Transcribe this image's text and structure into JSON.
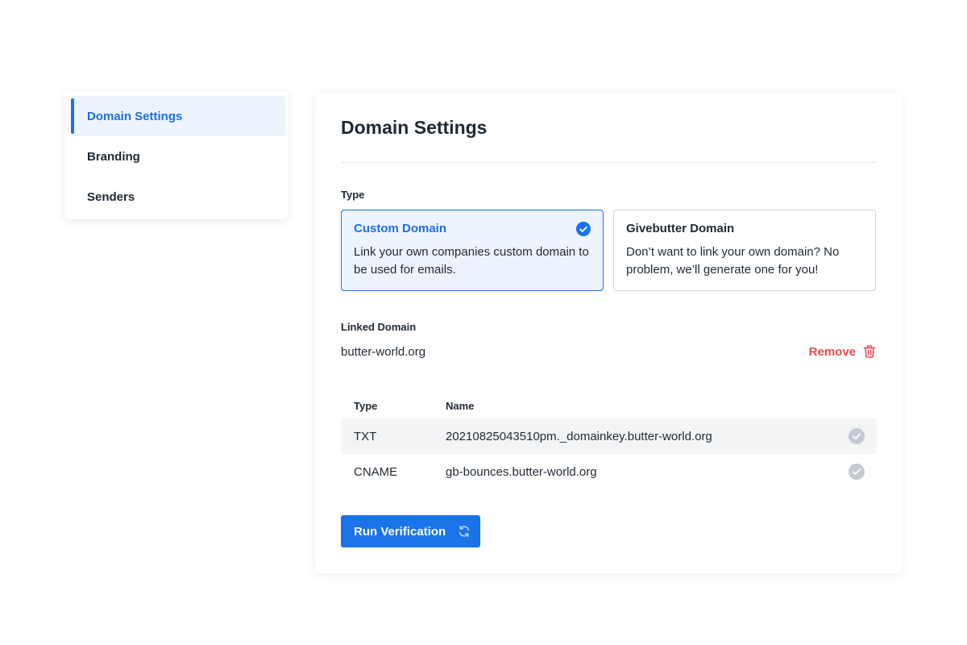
{
  "sidebar": {
    "items": [
      {
        "label": "Domain Settings",
        "active": true
      },
      {
        "label": "Branding",
        "active": false
      },
      {
        "label": "Senders",
        "active": false
      }
    ]
  },
  "main": {
    "title": "Domain Settings",
    "type_label": "Type",
    "options": [
      {
        "title": "Custom Domain",
        "description": "Link your own companies custom domain to be used for emails.",
        "selected": true
      },
      {
        "title": "Givebutter Domain",
        "description": "Don’t want to link your own domain? No problem, we’ll generate one for you!",
        "selected": false
      }
    ],
    "linked_domain_label": "Linked Domain",
    "linked_domain_value": "butter-world.org",
    "remove_label": "Remove",
    "records": {
      "headers": {
        "type": "Type",
        "name": "Name"
      },
      "rows": [
        {
          "type": "TXT",
          "name": "20210825043510pm._domainkey.butter-world.org",
          "status": "check-icon"
        },
        {
          "type": "CNAME",
          "name": "gb-bounces.butter-world.org",
          "status": "check-icon"
        }
      ]
    },
    "run_button_label": "Run Verification"
  },
  "colors": {
    "accent": "#1a73e8",
    "selected_bg": "#ecf4fe",
    "danger": "#ee4b4b",
    "muted_check": "#c4cad2"
  }
}
